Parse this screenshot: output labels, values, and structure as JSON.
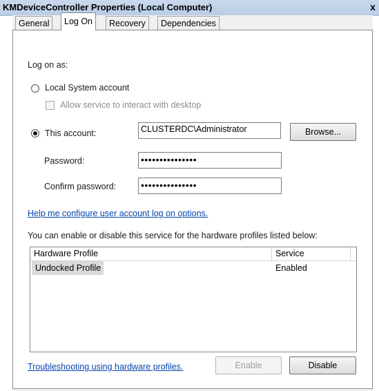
{
  "window": {
    "title": "KMDeviceController Properties (Local Computer)",
    "close_glyph": "x"
  },
  "tabs": [
    {
      "label": "General",
      "active": false
    },
    {
      "label": "Log On",
      "active": true
    },
    {
      "label": "Recovery",
      "active": false
    },
    {
      "label": "Dependencies",
      "active": false
    }
  ],
  "logon": {
    "heading": "Log on as:",
    "local_system_label": "Local System account",
    "allow_interact_label": "Allow service to interact with desktop",
    "this_account_label": "This account:",
    "account_value": "CLUSTERDC\\Administrator",
    "browse_label": "Browse...",
    "password_label": "Password:",
    "password_value": "•••••••••••••••",
    "confirm_label": "Confirm password:",
    "confirm_value": "•••••••••••••••",
    "selected": "this_account"
  },
  "help_link": "Help me configure user account log on options.",
  "profiles": {
    "description": "You can enable or disable this service for the hardware profiles listed below:",
    "columns": [
      "Hardware Profile",
      "Service"
    ],
    "rows": [
      {
        "profile": "Undocked Profile",
        "service": "Enabled"
      }
    ]
  },
  "footer": {
    "troubleshoot_link": "Troubleshooting using hardware profiles.",
    "enable_label": "Enable",
    "disable_label": "Disable"
  }
}
